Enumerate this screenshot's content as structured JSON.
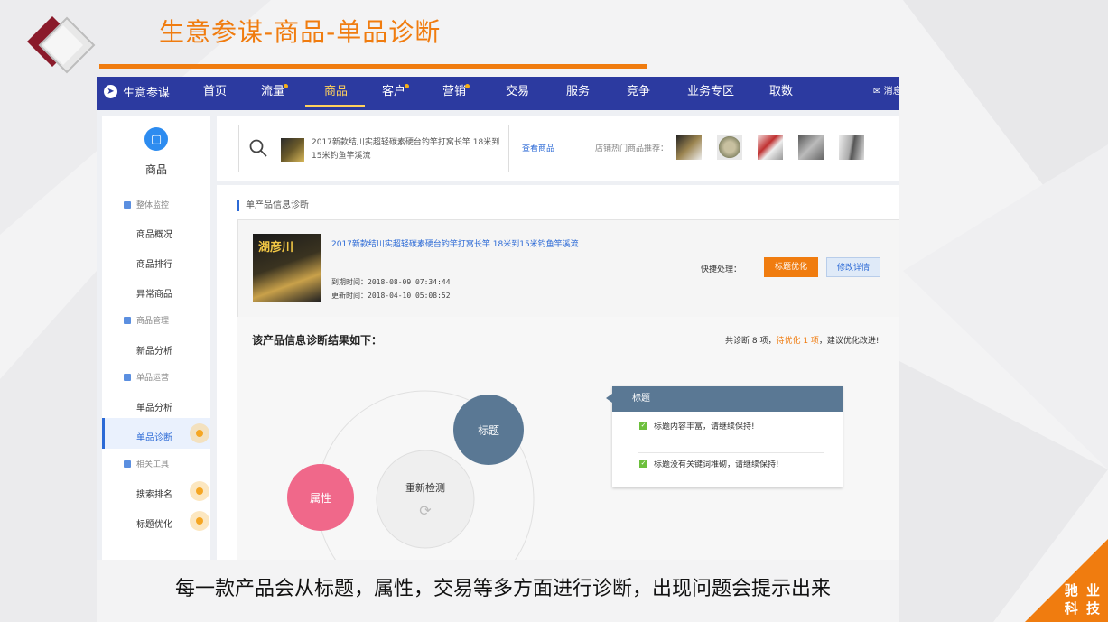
{
  "slide": {
    "title": "生意参谋-商品-单品诊断",
    "caption": "每一款产品会从标题，属性，交易等多方面进行诊断，出现问题会提示出来",
    "brand_line1": "驰 业",
    "brand_line2": "科 技",
    "accent_color": "#f07c0f"
  },
  "topnav": {
    "brand": "生意参谋",
    "items": [
      "首页",
      "流量",
      "商品",
      "客户",
      "营销",
      "交易",
      "服务",
      "竞争",
      "业务专区",
      "取数"
    ],
    "active": "商品",
    "message": "消息",
    "nav_color": "#2c3aa0"
  },
  "sidebar": {
    "title": "商品",
    "groups": [
      {
        "label": "整体监控",
        "items": [
          "商品概况",
          "商品排行",
          "异常商品"
        ]
      },
      {
        "label": "商品管理",
        "items": [
          "新品分析"
        ]
      },
      {
        "label": "单品运营",
        "items": [
          "单品分析",
          "单品诊断"
        ]
      },
      {
        "label": "相关工具",
        "items": [
          "搜索排名",
          "标题优化"
        ]
      }
    ],
    "active_item": "单品诊断"
  },
  "search": {
    "product_text": "2017新款结川实超轻碳素硬台钓竿打窝长竿 18米到15米钓鱼竿溪流",
    "view_link": "查看商品",
    "hot_label": "店铺热门商品推荐："
  },
  "diagnosis": {
    "section_title": "单产品信息诊断",
    "product_name": "2017新款结川实超轻碳素硬台钓竿打窝长竿 18米到15米钓鱼竿溪流",
    "product_image_text": "湖彦川",
    "expire_label": "到期时间：",
    "expire_time": "2018-08-09 07:34:44",
    "update_label": "更新时间：",
    "update_time": "2018-04-10 05:08:52",
    "quick_label": "快捷处理：",
    "btn_title_optimize": "标题优化",
    "btn_edit_detail": "修改详情",
    "result_title": "该产品信息诊断结果如下：",
    "summary_pre": "共诊断 8 项，",
    "summary_hl": "待优化 1 项",
    "summary_post": "，建议优化改进!",
    "bubbles": {
      "title": "标题",
      "attr": "属性",
      "recheck": "重新检测"
    },
    "info_card": {
      "header": "标题",
      "rows": [
        "标题内容丰富，请继续保持!",
        "标题没有关键词堆砌，请继续保持!"
      ]
    }
  }
}
